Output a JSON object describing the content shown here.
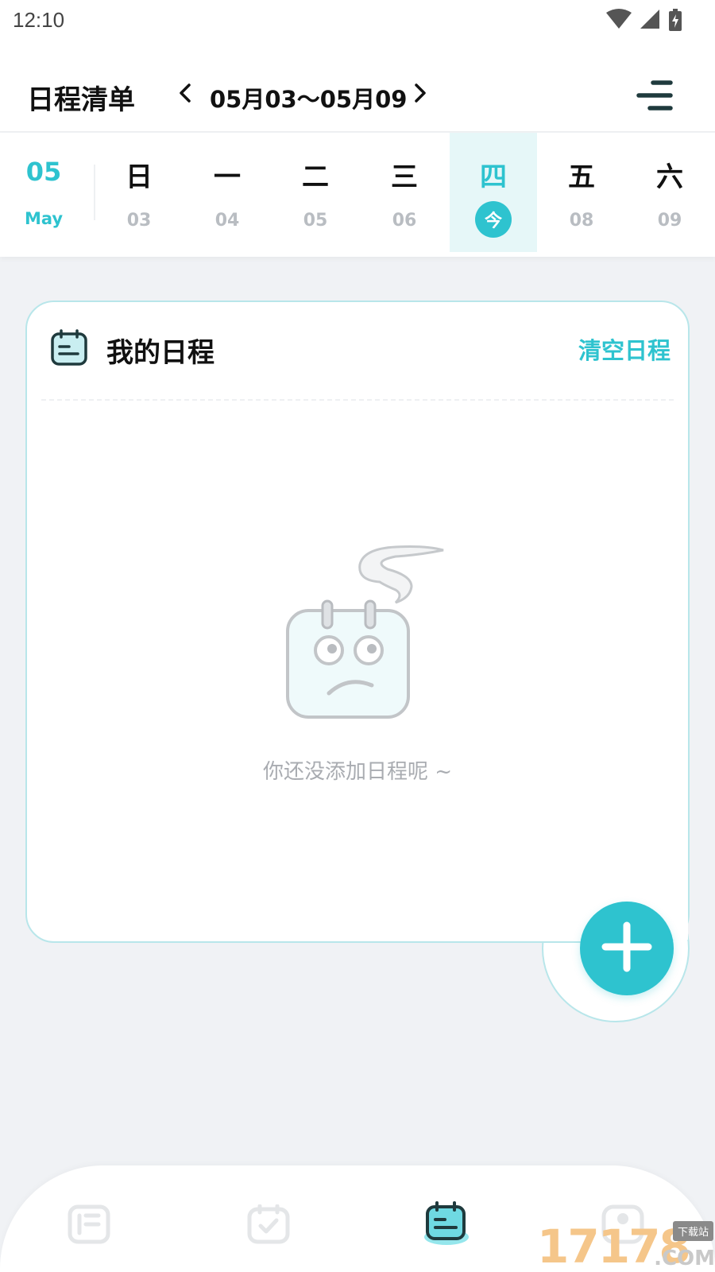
{
  "status_bar": {
    "time": "12:10",
    "icons": [
      "wifi-icon",
      "signal-icon",
      "battery-charging-icon"
    ]
  },
  "header": {
    "title": "日程清单",
    "date_range": "05月03～05月09",
    "prev_icon": "chevron-left-icon",
    "next_icon": "chevron-right-icon",
    "menu_icon": "menu-icon"
  },
  "week": {
    "month_number": "05",
    "month_name": "May",
    "days": [
      {
        "name": "日",
        "date": "03"
      },
      {
        "name": "一",
        "date": "04"
      },
      {
        "name": "二",
        "date": "05"
      },
      {
        "name": "三",
        "date": "06"
      },
      {
        "name": "四",
        "date": "今",
        "today": true
      },
      {
        "name": "五",
        "date": "08"
      },
      {
        "name": "六",
        "date": "09"
      }
    ]
  },
  "schedule_card": {
    "title": "我的日程",
    "clear_action": "清空日程",
    "empty_message": "你还没添加日程呢 ~",
    "icon": "calendar-icon"
  },
  "fab": {
    "icon": "plus-icon"
  },
  "bottom_nav": {
    "tabs": [
      {
        "icon": "list-icon",
        "active": false
      },
      {
        "icon": "checklist-icon",
        "active": false
      },
      {
        "icon": "schedule-icon",
        "active": true
      },
      {
        "icon": "profile-icon",
        "active": false
      }
    ]
  },
  "watermark": {
    "number": "17178",
    "sub": "下载站",
    "com": ".COM"
  },
  "colors": {
    "accent": "#2ec3cf",
    "accent_light": "#e6f7f8",
    "card_border": "#b8e6ea",
    "background": "#f0f2f5"
  }
}
